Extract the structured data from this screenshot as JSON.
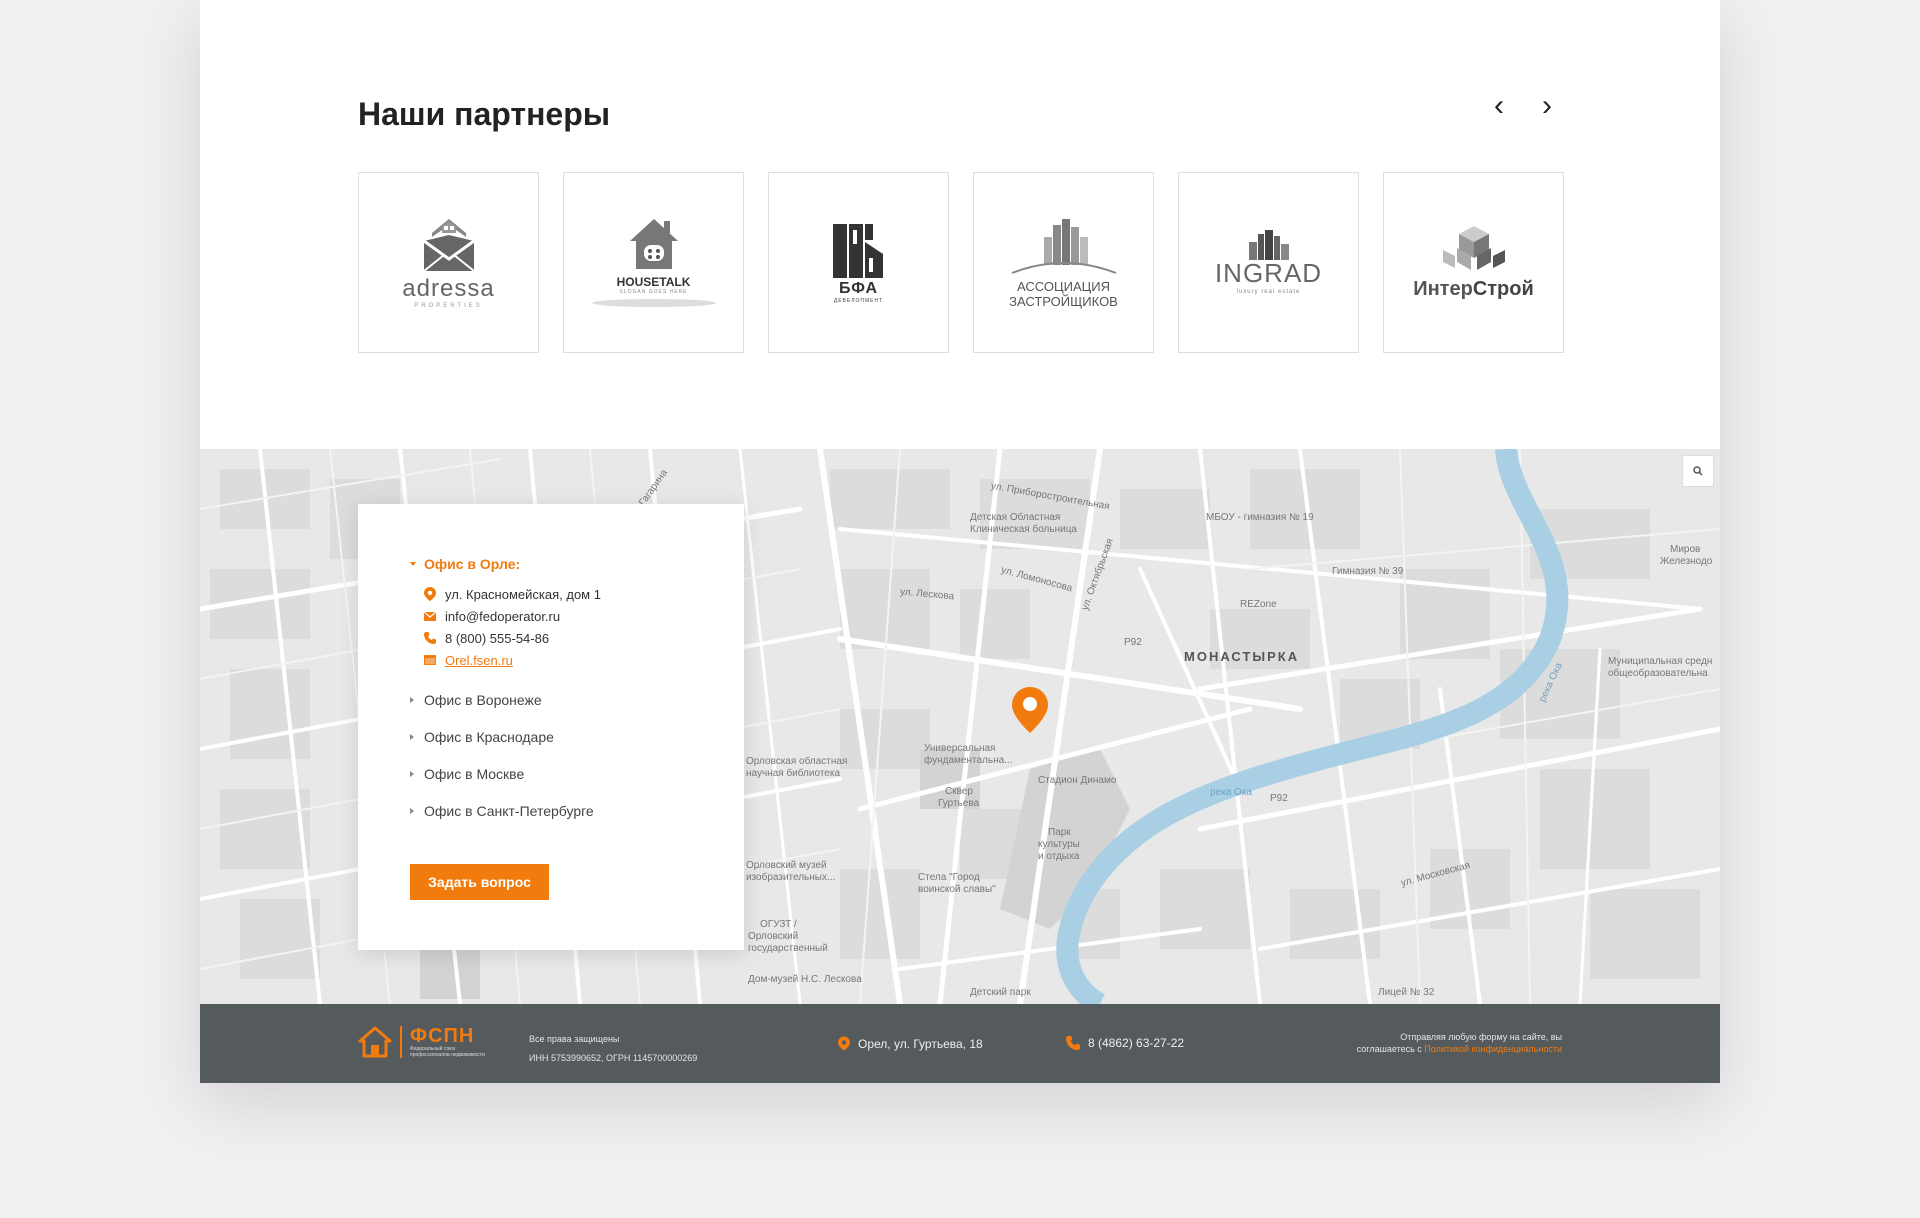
{
  "partners": {
    "title": "Наши партнеры",
    "prev_label": "‹",
    "next_label": "›",
    "logos": [
      {
        "name": "adressa",
        "sub": "PROPERTIES"
      },
      {
        "name": "HOUSETALK",
        "sub": "SLOGAN GOES HERE"
      },
      {
        "name": "БФА",
        "sub": "ДЕВЕЛОПМЕНТ"
      },
      {
        "name_line1": "АССОЦИАЦИЯ",
        "name_line2": "ЗАСТРОЙЩИКОВ"
      },
      {
        "name": "INGRAD",
        "sub": "luxury real estate"
      },
      {
        "name_part1": "Интер",
        "name_part2": "Строй"
      }
    ]
  },
  "offices": {
    "active": {
      "title": "Офис в Орле:",
      "address": "ул. Красномейская, дом 1",
      "email": "info@fedoperator.ru",
      "phone": "8 (800) 555-54-86",
      "site": "Orel.fsen.ru"
    },
    "others": [
      "Офис в Воронеже",
      "Офис в Краснодаре",
      "Офис в Москве",
      "Офис в Санкт-Петербурге"
    ],
    "ask_button": "Задать вопрос"
  },
  "map": {
    "labels": {
      "monastyrka": "МОНАСТЫРКА",
      "river1": "река Ока",
      "river2": "река Ока",
      "hospital1": "Детская Областная",
      "hospital2": "Клиническая больница",
      "gym19": "МБОУ - гимназия № 19",
      "gym39": "Гимназия № 39",
      "rezone": "REZone",
      "library1": "Универсальная",
      "library2": "фундаментальна...",
      "stadium": "Стадион Динамо",
      "square1": "Сквер",
      "square2": "Гуртьева",
      "park1": "Парк",
      "park2": "культуры",
      "park3": "и отдыха",
      "stela1": "Стела \"Город",
      "stela2": "воинской славы\"",
      "museum": "Дом-музей Н.С. Лескова",
      "dpark": "Детский парк",
      "lyceum": "Лицей № 32",
      "orlovsk1": "Орловская областная",
      "orlovsk2": "научная библиотека",
      "p92a": "Р92",
      "p92b": "Р92",
      "st1": "ул. Приборостроительная",
      "st2": "ул. Октябрьская",
      "st3": "ул. Ломоносова",
      "st4": "ул. Лескова",
      "st5": "ул. Московская",
      "st6": "ул. Гагарина",
      "munic1": "Муниципальная средн",
      "munic2": "общеобразовательна",
      "mir1": "Миров",
      "mir2": "Железнодо",
      "oguz1": "ОГУЗТ /",
      "oguz2": "Орловский",
      "oguz3": "государственный",
      "omuz1": "Орловский музей",
      "omuz2": "изобразительных..."
    },
    "zoom_icon": "search-icon"
  },
  "footer": {
    "logo_name": "ФСПН",
    "logo_sub": "Федеральный союз профессионалов недвижимости",
    "rights": "Все права защищены",
    "ids": "ИНН 5753990652,     ОГРН 1145700000269",
    "address": "Орел, ул. Гуртьева, 18",
    "phone": "8 (4862) 63-27-22",
    "policy_line1": "Отправляя любую форму на сайте, вы",
    "policy_prefix": "соглашаетесь с ",
    "policy_link": "Политикой конфиденциальности"
  },
  "colors": {
    "accent": "#f27b0e",
    "footer_bg": "#555a5d",
    "river": "#a9cfe4",
    "map_bg": "#e7e7e7"
  }
}
